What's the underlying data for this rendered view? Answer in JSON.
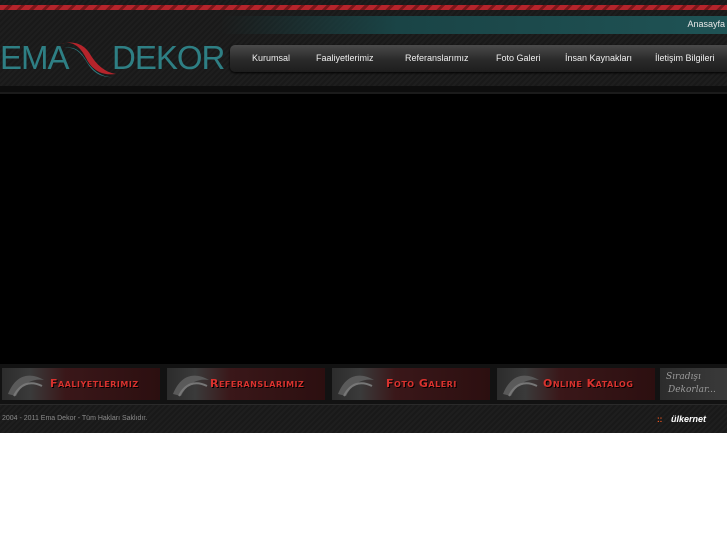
{
  "header": {
    "home_link": "Anasayfa",
    "logo": {
      "left": "EMA",
      "right": "DEKOR",
      "accent": "#2e7f84",
      "swoosh_red": "#b5242b"
    },
    "nav": [
      {
        "label": "Kurumsal"
      },
      {
        "label": "Faaliyetlerimiz"
      },
      {
        "label": "Referanslarımız"
      },
      {
        "label": "Foto Galeri"
      },
      {
        "label": "İnsan Kaynakları"
      },
      {
        "label": "İletişim Bilgileri"
      }
    ]
  },
  "banners": [
    {
      "label": "Faaliyetlerimiz"
    },
    {
      "label": "Referanslarimiz"
    },
    {
      "label": "Foto Galeri"
    },
    {
      "label": "Online Katalog"
    }
  ],
  "tagline": {
    "line1": "Sıradışı",
    "line2": "Dekorlar..."
  },
  "footer": {
    "copyright": "2004 - 2011 Ema Dekor - Tüm Hakları Saklıdır.",
    "credit": {
      "dots": "::",
      "brand": "ülkernet"
    }
  },
  "colors": {
    "accent_red": "#d9322e",
    "teal": "#2e7f84",
    "credit_orange": "#ff5a1f"
  }
}
